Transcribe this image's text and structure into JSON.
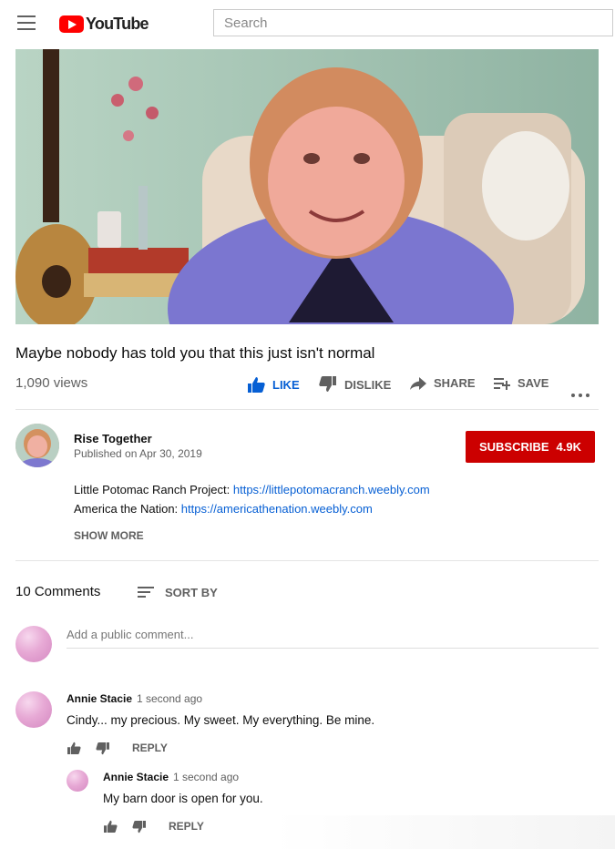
{
  "header": {
    "logo_text": "YouTube",
    "search_placeholder": "Search"
  },
  "video": {
    "title": "Maybe nobody has told you that this just isn't normal",
    "views": "1,090 views",
    "actions": {
      "like": "LIKE",
      "dislike": "DISLIKE",
      "share": "SHARE",
      "save": "SAVE"
    }
  },
  "channel": {
    "name": "Rise Together",
    "published": "Published on Apr 30, 2019",
    "subscribe_label": "SUBSCRIBE",
    "subscriber_count": "4.9K"
  },
  "description": {
    "line1_prefix": "Little Potomac Ranch Project: ",
    "line1_link": "https://littlepotomacranch.weebly.com",
    "line2_prefix": "America the Nation: ",
    "line2_link": "https://americathenation.weebly.com",
    "show_more": "SHOW MORE"
  },
  "comments": {
    "count": "10 Comments",
    "sort_label": "SORT BY",
    "add_placeholder": "Add a public comment...",
    "items": [
      {
        "author": "Annie Stacie",
        "time": "1 second ago",
        "text": "Cindy... my precious. My sweet. My everything. Be mine.",
        "reply_label": "REPLY"
      }
    ],
    "replies": [
      {
        "author": "Annie Stacie",
        "time": "1 second ago",
        "text": "My barn door is open for you.",
        "reply_label": "REPLY"
      }
    ]
  }
}
